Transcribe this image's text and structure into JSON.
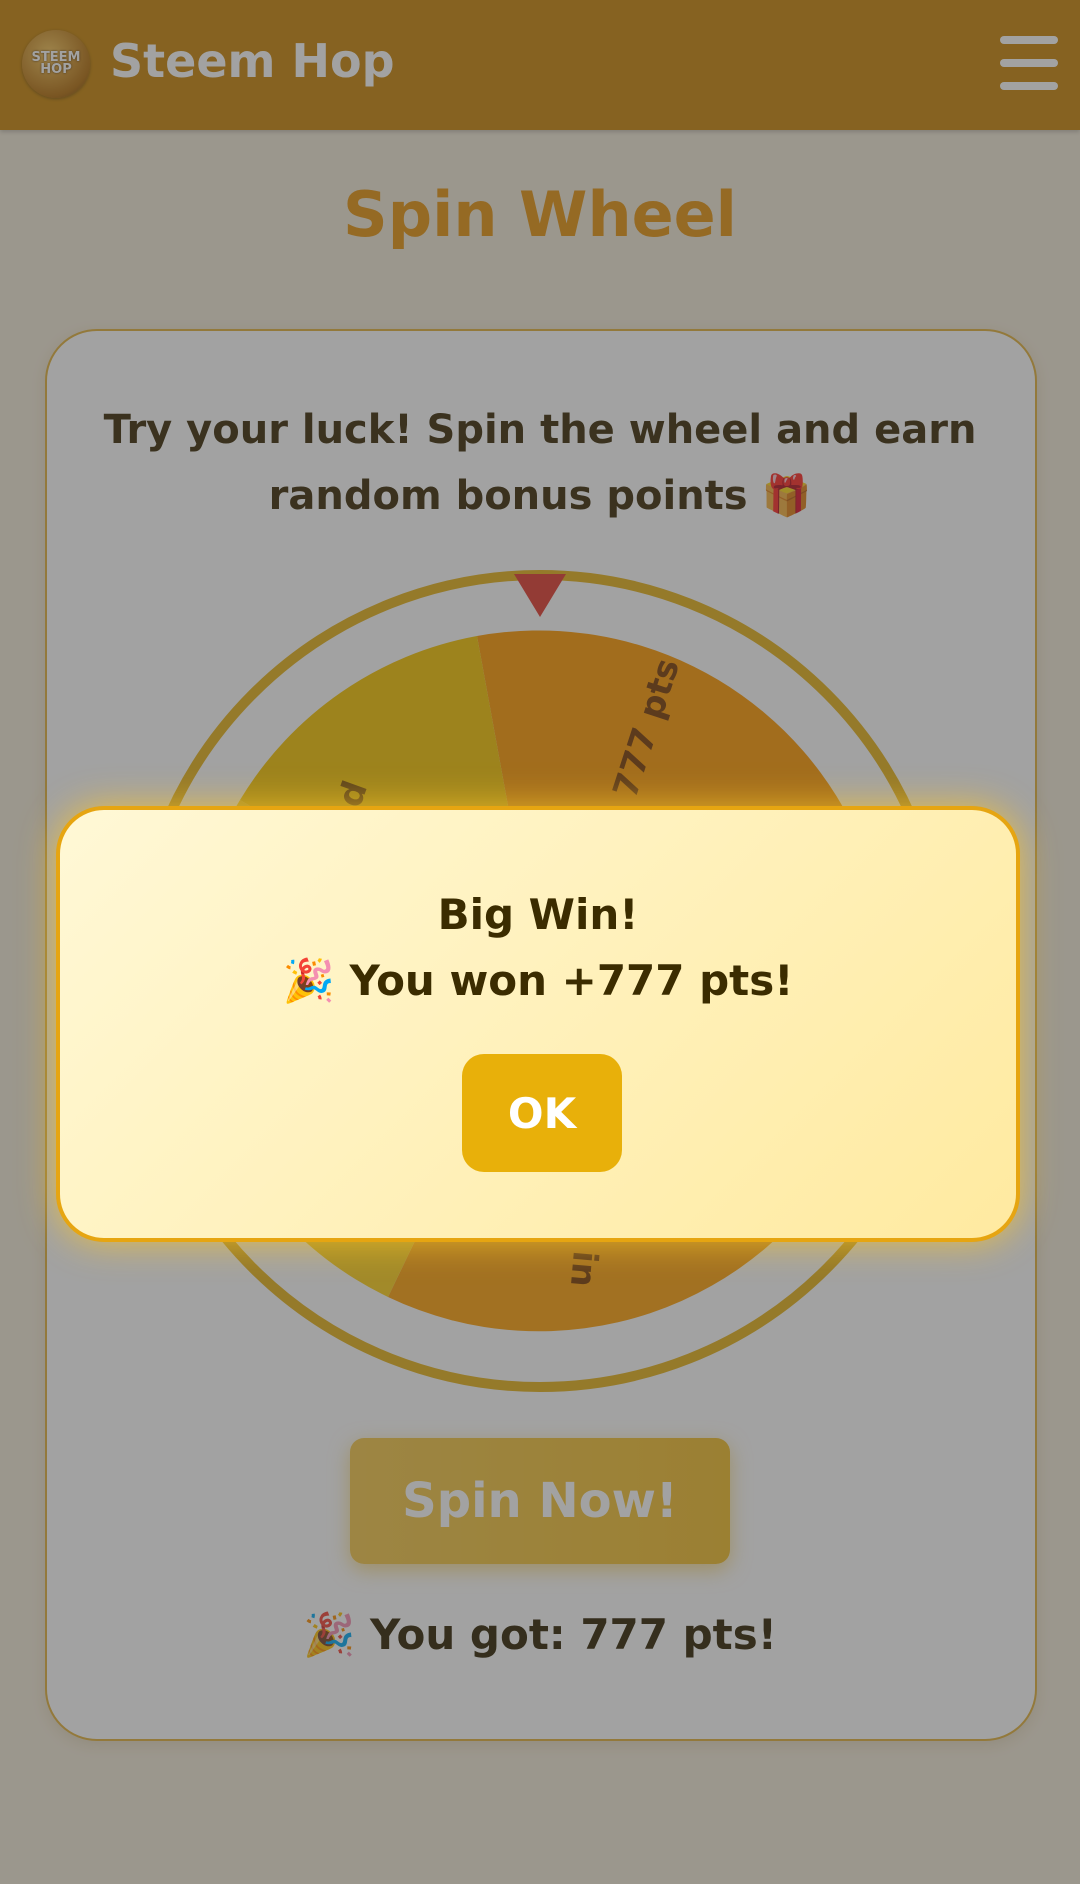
{
  "header": {
    "logo_text_line1": "STEEM",
    "logo_text_line2": "HOP",
    "app_title": "Steem Hop",
    "menu_icon": "hamburger-menu-icon"
  },
  "page": {
    "title": "Spin Wheel",
    "intro_line1": "Try your luck! Spin the wheel and earn",
    "intro_line2": "random bonus points 🎁"
  },
  "wheel": {
    "pointer_icon": "triangle-down-pointer-icon",
    "visible_segment_labels": [
      "pts",
      "777 pts",
      "in"
    ],
    "colors": {
      "rim": "#e6b21a",
      "segment_yellow": "#f5c400",
      "segment_orange": "#ff9a00",
      "segment_amber": "#f7a800",
      "pointer": "#e23b2e"
    }
  },
  "spin_button": {
    "label": "Spin Now!"
  },
  "result_text": "🎉 You got: 777 pts!",
  "modal": {
    "title": "Big Win!",
    "message": "🎉 You won +777 pts!",
    "ok_label": "OK"
  },
  "colors": {
    "header_bg": "#c98508",
    "title": "#e6940f",
    "accent": "#e8b00a"
  }
}
